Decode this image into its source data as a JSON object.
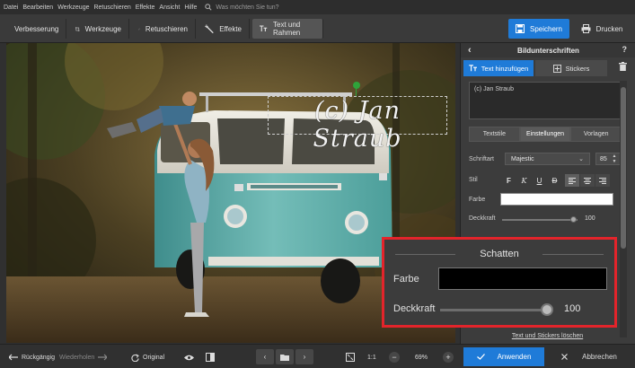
{
  "menu": {
    "items": [
      "Datei",
      "Bearbeiten",
      "Werkzeuge",
      "Retuschieren",
      "Effekte",
      "Ansicht",
      "Hilfe"
    ],
    "search_placeholder": "Was möchten Sie tun?"
  },
  "toolbar": {
    "tools": [
      {
        "label": "Verbesserung",
        "icon": "sliders-icon"
      },
      {
        "label": "Werkzeuge",
        "icon": "crop-icon"
      },
      {
        "label": "Retuschieren",
        "icon": "brush-icon"
      },
      {
        "label": "Effekte",
        "icon": "magic-wand-icon"
      },
      {
        "label": "Text und Rahmen",
        "icon": "text-icon",
        "active": true
      }
    ],
    "save_label": "Speichern",
    "print_label": "Drucken"
  },
  "canvas": {
    "watermark_text": "(c) Jan Straub"
  },
  "panel": {
    "title": "Bildunterschriften",
    "help": "?",
    "tab_add_text": "Text hinzufügen",
    "tab_stickers": "Stickers",
    "text_value": "(c) Jan Straub",
    "subtabs": [
      "Textstile",
      "Einstellungen",
      "Vorlagen"
    ],
    "font_label": "Schriftart",
    "font_value": "Majestic",
    "font_size": "85",
    "style_label": "Stil",
    "style_buttons": [
      "F",
      "K",
      "U",
      "Ð"
    ],
    "color_label": "Farbe",
    "color_value": "#ffffff",
    "opacity_label": "Deckkraft",
    "opacity_value": "100",
    "link_text": "Text und Stickers löschen"
  },
  "shadow": {
    "title": "Schatten",
    "color_label": "Farbe",
    "color_value": "#000000",
    "opacity_label": "Deckkraft",
    "opacity_value": "100"
  },
  "bottom": {
    "undo": "Rückgängig",
    "redo": "Wiederholen",
    "original": "Original",
    "ratio": "1:1",
    "zoom": "69%",
    "apply": "Anwenden",
    "cancel": "Abbrechen"
  },
  "colors": {
    "accent": "#1f7bd8",
    "highlight_frame": "#e3242b",
    "handle": "#2fa33a"
  }
}
